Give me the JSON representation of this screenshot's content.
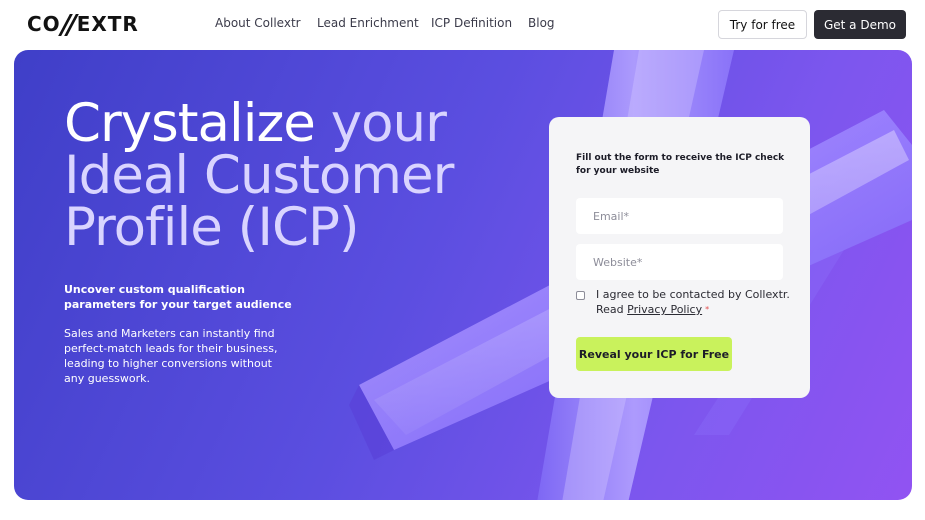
{
  "header": {
    "logo": "CO//EXTR",
    "logo_left": "CO",
    "logo_right": "EXTR",
    "nav": [
      "About Collextr",
      "Lead Enrichment",
      "ICP Definition",
      "Blog"
    ],
    "try_label": "Try for free",
    "demo_label": "Get a Demo"
  },
  "hero": {
    "headline_em": "Crystalize",
    "headline_line1_rest": " your",
    "headline_line2": "Ideal Customer",
    "headline_line3": "Profile (ICP)",
    "subhead": "Uncover custom qualification parameters for your target audience",
    "body": "Sales and Marketers can instantly find perfect-match leads for their business, leading to higher conversions without any guesswork."
  },
  "form": {
    "intro": "Fill out the form to receive the ICP check for your website",
    "email_placeholder": "Email*",
    "website_placeholder": "Website*",
    "consent_text": "I agree to be contacted by Collextr. Read ",
    "privacy_link": "Privacy Policy",
    "required_mark": "*",
    "submit_label": "Reveal your ICP for Free"
  },
  "colors": {
    "hero_start": "#3f3fc8",
    "hero_end": "#9153f2",
    "cta_green": "#c9f25c",
    "dark_button": "#2b2b33"
  }
}
